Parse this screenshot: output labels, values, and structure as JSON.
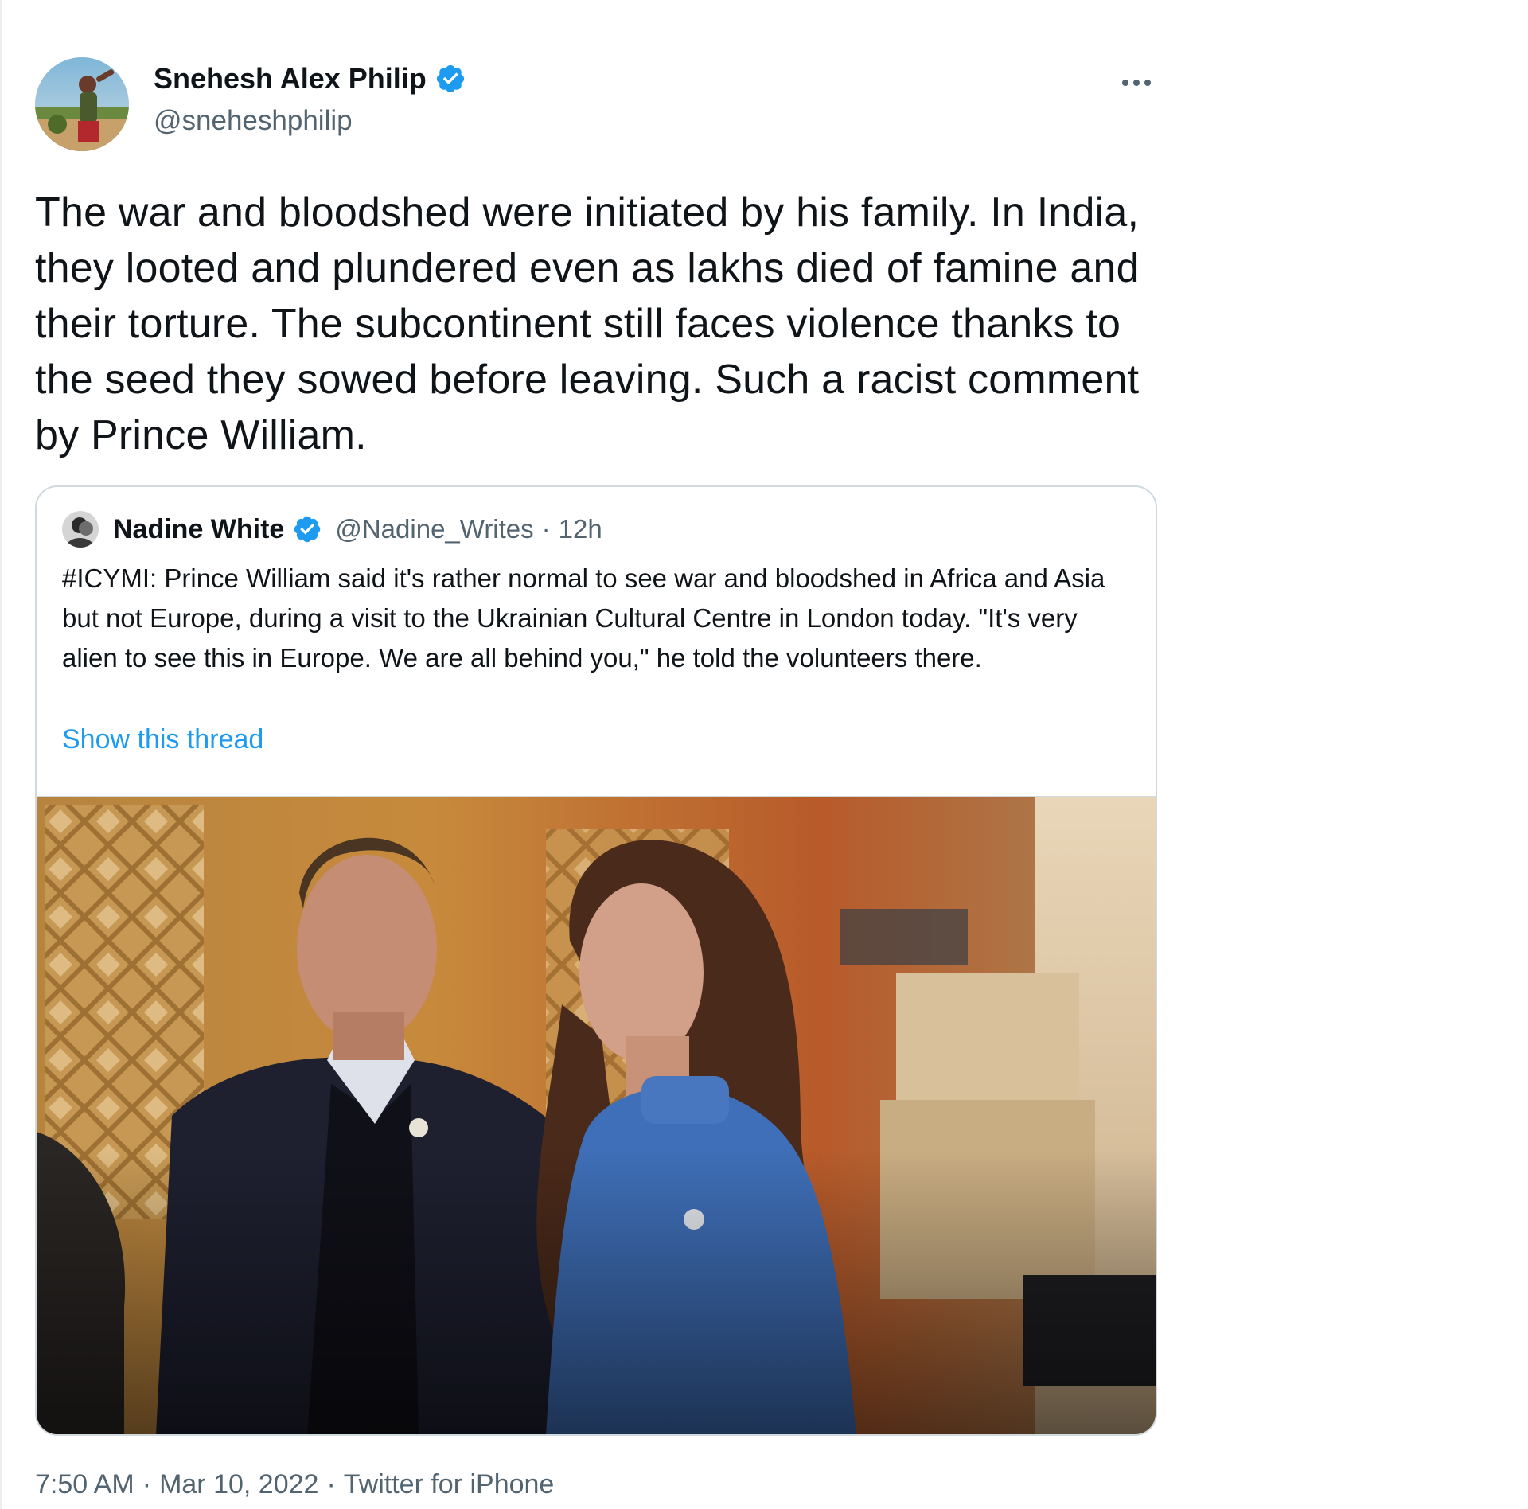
{
  "tweet": {
    "author": {
      "display_name": "Snehesh Alex Philip",
      "handle": "@sneheshphilip",
      "verified": true
    },
    "text": "The war and bloodshed were initiated by his family. In India, they looted and plundered even as lakhs died of famine and their torture. The subcontinent still faces violence thanks to the seed they sowed before leaving. Such a racist comment by Prince William.",
    "more_icon": "more-horizontal-icon",
    "time": "7:50 AM",
    "separator": "·",
    "date": "Mar 10, 2022",
    "source": "Twitter for iPhone"
  },
  "quote": {
    "author": {
      "display_name": "Nadine White",
      "handle": "@Nadine_Writes",
      "verified": true
    },
    "separator": "·",
    "age": "12h",
    "text": "#ICYMI: Prince William said it's rather normal to see war and bloodshed in Africa and Asia but not Europe, during a visit to the Ukrainian Cultural Centre in London today. \"It's very alien to see this in Europe. We are all behind you,\" he told the volunteers there.",
    "show_thread_label": "Show this thread"
  },
  "colors": {
    "text_primary": "#0f1419",
    "text_secondary": "#536471",
    "link_blue": "#1d9bf0",
    "verified_blue": "#1d9bf0",
    "border": "#cfd9de"
  }
}
